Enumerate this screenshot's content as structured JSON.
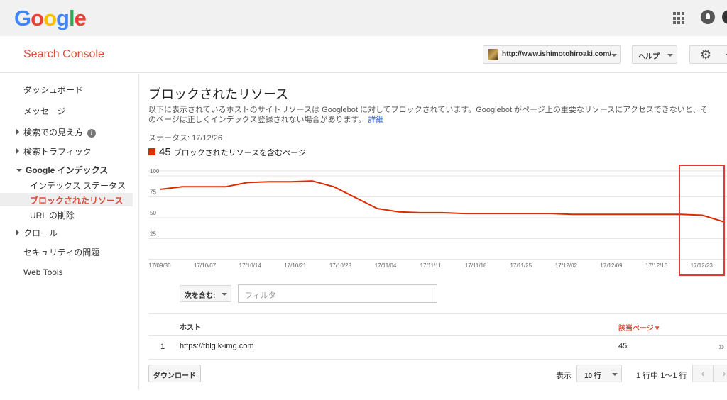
{
  "google_logo": "Google",
  "app_title": "Search Console",
  "site_selector": {
    "value": "http://www.ishimotohiroaki.com/"
  },
  "help_label": "ヘルプ",
  "sidebar": {
    "dashboard": "ダッシュボード",
    "messages": "メッセージ",
    "search_appearance": "検索での見え方",
    "search_traffic": "検索トラフィック",
    "google_index": "Google インデックス",
    "index_status": "インデックス ステータス",
    "blocked_resources": "ブロックされたリソース",
    "remove_urls": "URL の削除",
    "crawl": "クロール",
    "security_issues": "セキュリティの問題",
    "web_tools": "Web Tools"
  },
  "main": {
    "title": "ブロックされたリソース",
    "description_line1": "以下に表示されているホストのサイトリソースは Googlebot に対してブロックされています。Googlebot がページ上の重要なリソースにアクセスできないと、そ",
    "description_line2": "のページは正しくインデックス登録されない場合があります。",
    "details_link": "詳細",
    "status": "ステータス: 17/12/26",
    "legend_count": "45",
    "legend_label": "ブロックされたリソースを含むページ"
  },
  "chart_data": {
    "type": "line",
    "series": [
      {
        "name": "ブロックされたリソースを含むページ",
        "color": "#dd2c00",
        "values": [
          84,
          87,
          87,
          87,
          92,
          93,
          93,
          94,
          87,
          74,
          61,
          57,
          56,
          56,
          55,
          55,
          55,
          55,
          55,
          54,
          54,
          54,
          54,
          54,
          54,
          53,
          45
        ]
      }
    ],
    "x_ticks": [
      "17/09/30",
      "17/10/07",
      "17/10/14",
      "17/10/21",
      "17/10/28",
      "17/11/04",
      "17/11/11",
      "17/11/18",
      "17/11/25",
      "17/12/02",
      "17/12/09",
      "17/12/16",
      "17/12/23"
    ],
    "y_ticks": [
      100,
      75,
      50,
      25
    ],
    "ylim": [
      0,
      100
    ],
    "grid": true
  },
  "filter": {
    "select_label": "次を含む:",
    "input_placeholder": "フィルタ"
  },
  "table": {
    "headers": {
      "host": "ホスト",
      "pages": "該当ページ▼"
    },
    "rows": [
      {
        "num": "1",
        "host": "https://tblg.k-img.com",
        "pages": "45"
      }
    ]
  },
  "footer": {
    "download_label": "ダウンロード",
    "show_label": "表示",
    "rows_per_page": "10 行",
    "range_label": "1 行中 1〜1 行"
  }
}
